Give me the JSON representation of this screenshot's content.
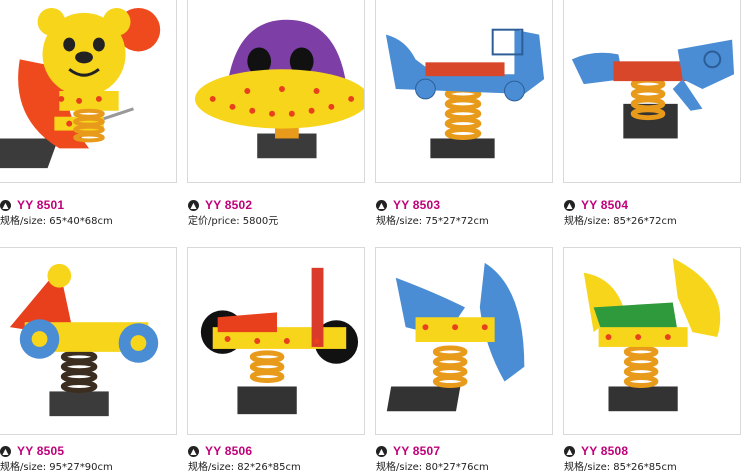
{
  "products": [
    {
      "code": "YY 8501",
      "spec": "规格/size: 65*40*68cm",
      "image": "bear-spring-rider"
    },
    {
      "code": "YY 8502",
      "spec": "定价/price: 5800元",
      "image": "ufo-spring-rider"
    },
    {
      "code": "YY 8503",
      "spec": "规格/size: 75*27*72cm",
      "image": "truck-spring-rider"
    },
    {
      "code": "YY 8504",
      "spec": "规格/size: 85*26*72cm",
      "image": "helicopter-spring-rider"
    },
    {
      "code": "YY 8505",
      "spec": "规格/size: 95*27*90cm",
      "image": "motorbike-spring-rider"
    },
    {
      "code": "YY 8506",
      "spec": "规格/size: 82*26*85cm",
      "image": "bicycle-spring-rider"
    },
    {
      "code": "YY 8507",
      "spec": "规格/size: 80*27*76cm",
      "image": "dolphin-spring-rider"
    },
    {
      "code": "YY 8508",
      "spec": "规格/size: 85*26*85cm",
      "image": "horse-spring-rider"
    }
  ],
  "colors": {
    "code": "#c0007a",
    "border": "#d9d9d9"
  }
}
